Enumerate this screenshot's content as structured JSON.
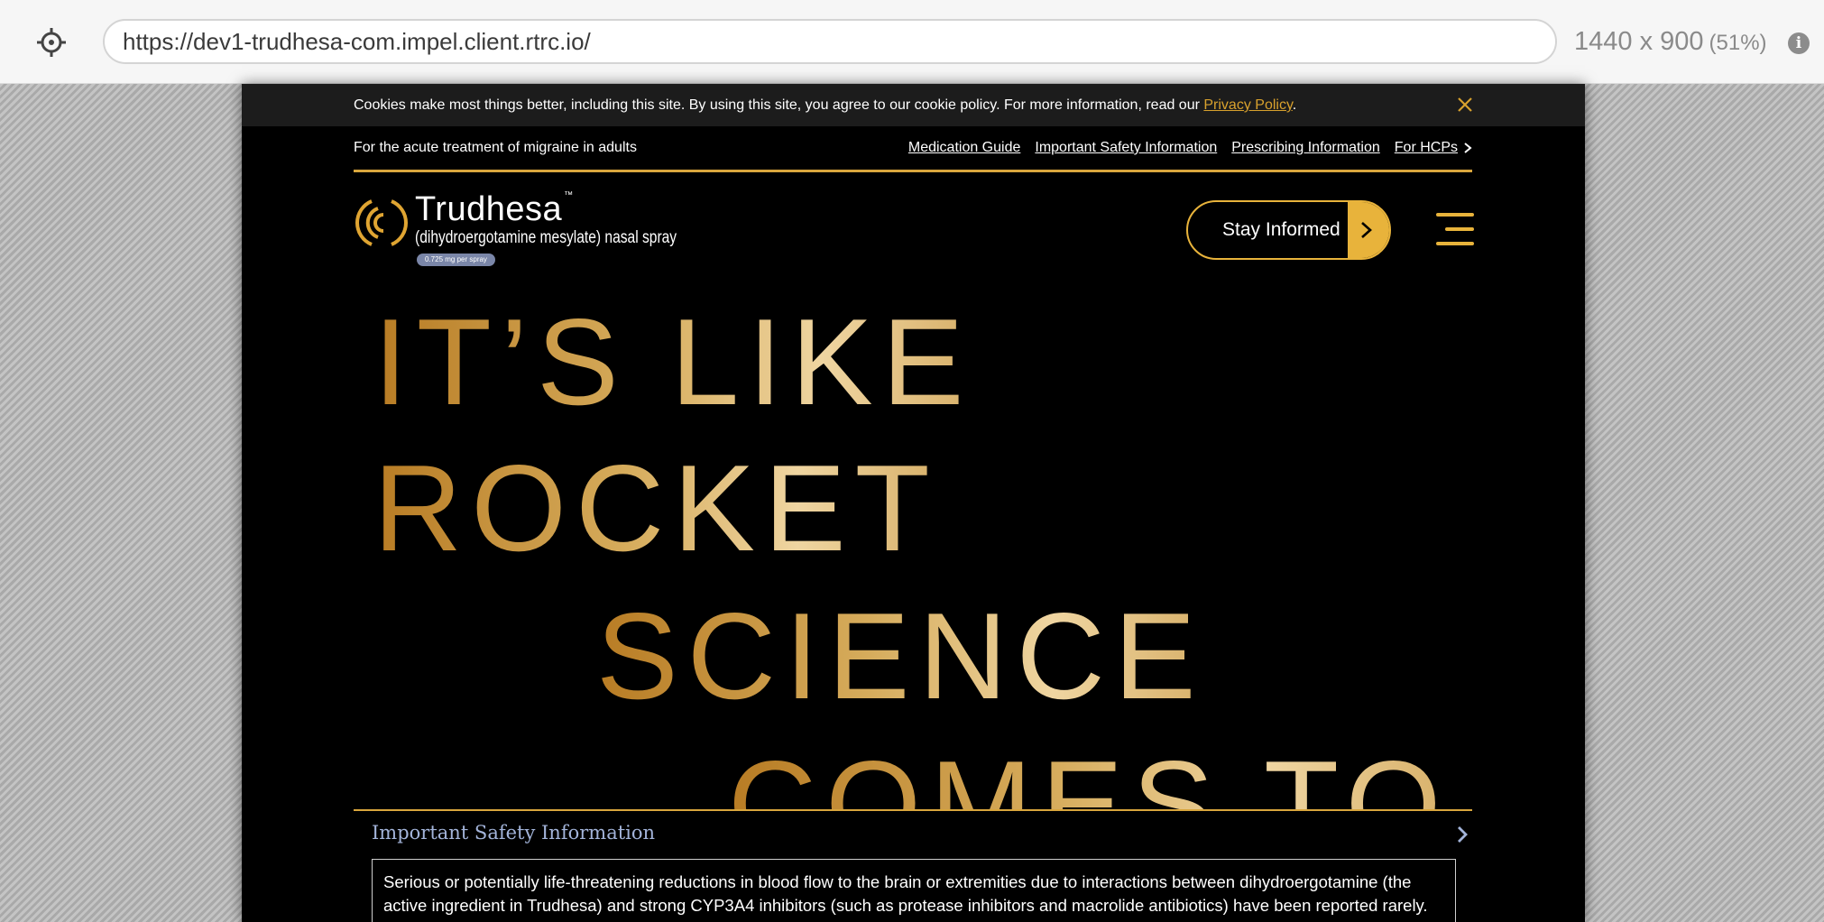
{
  "viewer": {
    "url": "https://dev1-trudhesa-com.impel.client.rtrc.io/",
    "dimensions": "1440 x 900",
    "zoom": "(51%)"
  },
  "cookie_banner": {
    "text": "Cookies make most things better, including this site. By using this site, you agree to our cookie policy. For more information, read our ",
    "link": "Privacy Policy",
    "suffix": "."
  },
  "utility_bar": {
    "tagline": "For the acute treatment of migraine in adults",
    "links": [
      "Medication Guide",
      "Important Safety Information",
      "Prescribing Information",
      "For HCPs"
    ]
  },
  "logo": {
    "name": "Trudhesa",
    "tm": "™",
    "subtitle": "(dihydroergotamine mesylate) nasal spray",
    "dose": "0.725 mg per spray"
  },
  "header": {
    "cta": "Stay Informed"
  },
  "hero": {
    "lines": [
      "IT’S LIKE",
      "ROCKET",
      "SCIENCE",
      "COMES TO"
    ]
  },
  "isi": {
    "title": "Important Safety Information",
    "body": "Serious or potentially life-threatening reductions in blood flow to the brain or extremities due to interactions between dihydroergotamine (the active ingredient in Trudhesa) and strong CYP3A4 inhibitors (such as protease inhibitors and macrolide antibiotics) have been reported rarely."
  },
  "colors": {
    "gold": "#e8b33b",
    "isi_title": "#a3b4da",
    "site_bg": "#000000"
  }
}
